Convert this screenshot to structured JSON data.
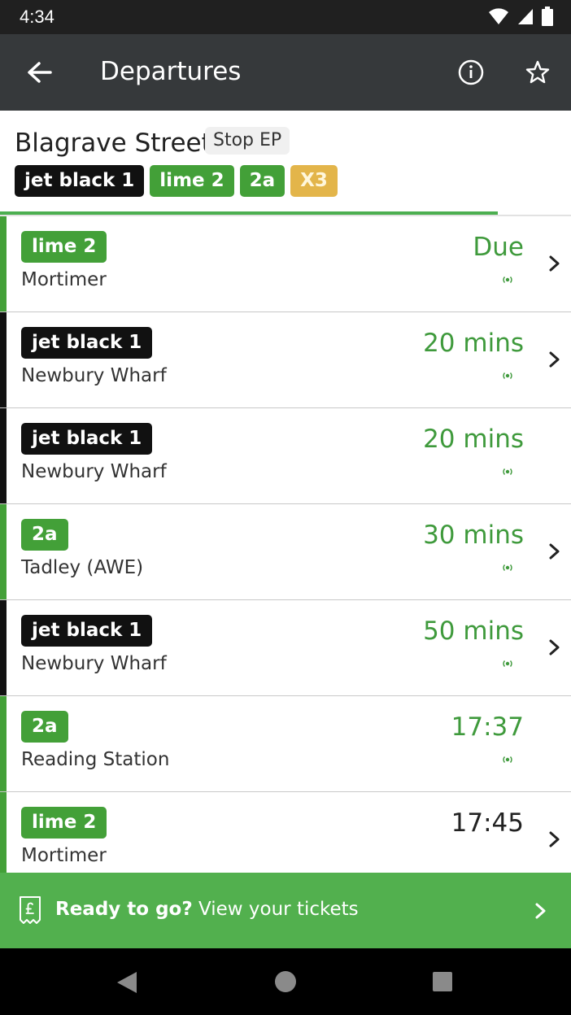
{
  "status_bar": {
    "time": "4:34"
  },
  "app_bar": {
    "title": "Departures",
    "back_icon": "arrow-left-icon",
    "info_icon": "info-circle-icon",
    "favourite_icon": "star-outline-icon"
  },
  "stop": {
    "name": "Blagrave Street",
    "code": "Stop EP",
    "routes": [
      {
        "label": "jet black 1",
        "color": "#111111",
        "text_color": "#ffffff"
      },
      {
        "label": "lime 2",
        "color": "#43a038",
        "text_color": "#ffffff"
      },
      {
        "label": "2a",
        "color": "#43a038",
        "text_color": "#ffffff"
      },
      {
        "label": "X3",
        "color": "#e3b54a",
        "text_color": "#fff7dc"
      }
    ]
  },
  "departures": [
    {
      "route": "lime 2",
      "route_color": "#43a038",
      "destination": "Mortimer",
      "time": "Due",
      "live": true,
      "has_chevron": true
    },
    {
      "route": "jet black 1",
      "route_color": "#111111",
      "destination": "Newbury Wharf",
      "time": "20 mins",
      "live": true,
      "has_chevron": true
    },
    {
      "route": "jet black 1",
      "route_color": "#111111",
      "destination": "Newbury Wharf",
      "time": "20 mins",
      "live": true,
      "has_chevron": false
    },
    {
      "route": "2a",
      "route_color": "#43a038",
      "destination": "Tadley (AWE)",
      "time": "30 mins",
      "live": true,
      "has_chevron": true
    },
    {
      "route": "jet black 1",
      "route_color": "#111111",
      "destination": "Newbury Wharf",
      "time": "50 mins",
      "live": true,
      "has_chevron": true
    },
    {
      "route": "2a",
      "route_color": "#43a038",
      "destination": "Reading Station",
      "time": "17:37",
      "live": true,
      "has_chevron": false
    },
    {
      "route": "lime 2",
      "route_color": "#43a038",
      "destination": "Mortimer",
      "time": "17:45",
      "live": false,
      "has_chevron": true
    }
  ],
  "tickets_banner": {
    "bold_text": "Ready to go?",
    "text": "View your tickets",
    "icon": "ticket-pound-icon"
  },
  "colors": {
    "live_green": "#3f9a3c",
    "banner_green": "#52b04e",
    "app_bar": "#36393b"
  }
}
